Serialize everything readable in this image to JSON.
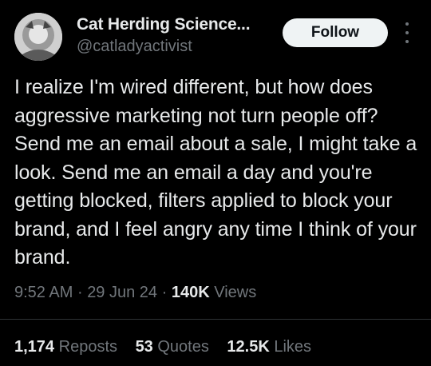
{
  "author": {
    "display_name": "Cat Herding Science...",
    "handle": "@catladyactivist"
  },
  "follow_label": "Follow",
  "tweet": {
    "text": "I realize I'm wired different, but how does aggressive marketing not turn people off? Send me an email about a sale, I might take a look. Send me an email a day and you're getting blocked, filters applied to block your brand, and I feel angry any time I think of your brand."
  },
  "meta": {
    "time": "9:52 AM",
    "separator": "·",
    "date": "29 Jun 24",
    "views_count": "140K",
    "views_label": "Views"
  },
  "stats": {
    "reposts_count": "1,174",
    "reposts_label": "Reposts",
    "quotes_count": "53",
    "quotes_label": "Quotes",
    "likes_count": "12.5K",
    "likes_label": "Likes"
  },
  "colors": {
    "background": "#000000",
    "text": "#e7e9ea",
    "secondary": "#71767b",
    "follow_bg": "#eff3f4"
  },
  "icons": {
    "more": "more-vertical-icon"
  }
}
